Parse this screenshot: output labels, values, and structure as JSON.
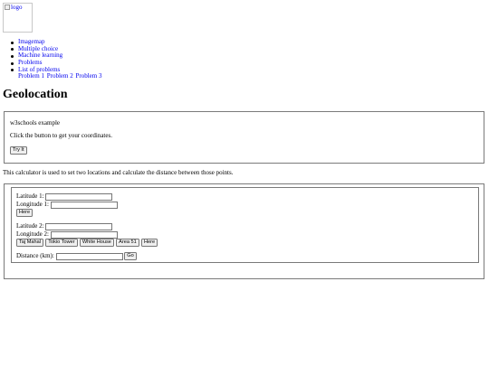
{
  "logo": {
    "alt": "logo"
  },
  "nav": {
    "items": [
      "Imagemap",
      "Multiple choice",
      "Machine learning",
      "Problems",
      "List of problems"
    ],
    "sub_items": [
      "Problem 1",
      "Problem 2",
      "Problem 3"
    ]
  },
  "page_title": "Geolocation",
  "example": {
    "heading": "w3schools example",
    "instruction": "Click the button to get your coordinates.",
    "try_button": "Try It"
  },
  "description": "This calculator is used to set two locations and calculate the distance between those points.",
  "calculator": {
    "lat1_label": "Latitude 1:",
    "lon1_label": "Longitude 1:",
    "lat1_value": "",
    "lon1_value": "",
    "here_button_1": "Here",
    "lat2_label": "Latitude 2:",
    "lon2_label": "Longitude 2:",
    "lat2_value": "",
    "lon2_value": "",
    "presets": [
      "Taj Mahal",
      "Tokio Tower",
      "White House",
      "Area 51",
      "Here"
    ],
    "distance_label": "Distance (km):",
    "distance_value": "",
    "go_button": "Go"
  }
}
